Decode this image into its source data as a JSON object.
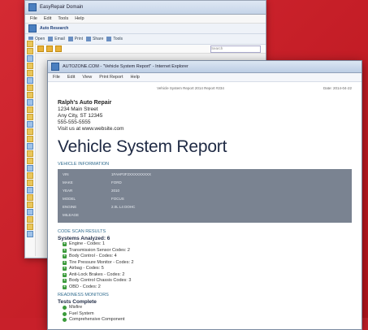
{
  "back_window": {
    "title": "EasyRepair Domain",
    "menu": [
      "File",
      "Edit",
      "Tools",
      "Help"
    ],
    "subtitle": "Auto Research",
    "toolbar": [
      "Open",
      "Email",
      "Print",
      "Share",
      "Tools"
    ],
    "search_placeholder": "Search"
  },
  "front_window": {
    "title": "AUTOZONE.COM - \"Vehicle System Report\" - Internet Explorer",
    "menu": [
      "File",
      "Edit",
      "View",
      "Print Report",
      "Help"
    ]
  },
  "document": {
    "header_left": "",
    "header_center": "Vehicle System Report  2014 Report #234",
    "header_right": "Date: 2014-04-22",
    "shop": {
      "name": "Ralph's Auto Repair",
      "address1": "1234 Main Street",
      "address2": "Any City, ST 12345",
      "phone": "555-555-5555",
      "web": "Visit us at www.website.com"
    },
    "report_title": "Vehicle System Report",
    "vehicle_info_label": "VEHICLE INFORMATION",
    "vehicle_info": [
      {
        "k": "VIN",
        "v": "1FAHP3F2XXXXXXXXX"
      },
      {
        "k": "MAKE",
        "v": "FORD"
      },
      {
        "k": "YEAR",
        "v": "2010"
      },
      {
        "k": "MODEL",
        "v": "FOCUS"
      },
      {
        "k": "ENGINE",
        "v": "2.0L L4 DOHC"
      },
      {
        "k": "MILEAGE",
        "v": ""
      }
    ],
    "code_scan_label": "CODE SCAN RESULTS",
    "systems_analyzed": "Systems Analyzed: 6",
    "systems": [
      "Engine - Codes: 1",
      "Transmission Sensor Codes: 2",
      "Body Control - Codes: 4",
      "Tire Pressure Monitor - Codes: 2",
      "Airbag - Codes: 5",
      "Anti-Lock Brakes - Codes: 2",
      "Body Control Chassis Codes: 3",
      "OBD - Codes: 2"
    ],
    "readiness_label": "READINESS MONITORS",
    "tests_complete": "Tests Complete",
    "monitors": [
      "Misfire",
      "Fuel System",
      "Comprehensive Component"
    ]
  }
}
